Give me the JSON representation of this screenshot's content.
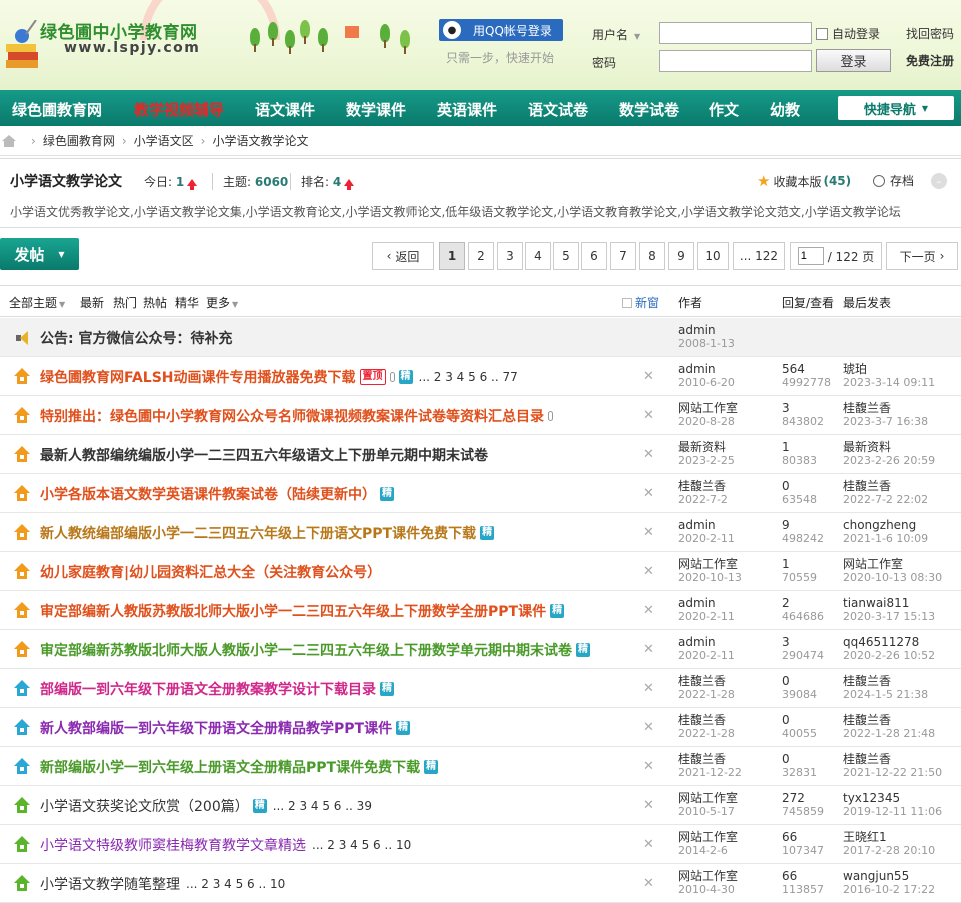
{
  "site": {
    "name": "绿色圃中小学教育网",
    "url": "www.lspjy.com"
  },
  "qq": {
    "button": "用QQ帐号登录",
    "hint": "只需一步，快速开始"
  },
  "login": {
    "username_label": "用户名",
    "password_label": "密码",
    "auto_login": "自动登录",
    "login_button": "登录",
    "forgot": "找回密码",
    "register": "免费注册"
  },
  "nav": {
    "items": [
      {
        "label": "绿色圃教育网"
      },
      {
        "label": "教学视频辅导"
      },
      {
        "label": "语文课件"
      },
      {
        "label": "数学课件"
      },
      {
        "label": "英语课件"
      },
      {
        "label": "语文试卷"
      },
      {
        "label": "数学试卷"
      },
      {
        "label": "作文"
      },
      {
        "label": "幼教"
      }
    ],
    "active_color": "#e52727",
    "quick_nav": "快捷导航"
  },
  "breadcrumb": [
    "绿色圃教育网",
    "小学语文区",
    "小学语文教学论文"
  ],
  "forum": {
    "title": "小学语文教学论文",
    "today_label": "今日:",
    "today": "1",
    "topics_label": "主题:",
    "topics": "6060",
    "rank_label": "排名:",
    "rank": "4",
    "favorite": "收藏本版",
    "favorite_count": "(45)",
    "archive": "存档",
    "tags": "小学语文优秀教学论文,小学语文教学论文集,小学语文教育论文,小学语文教师论文,低年级语文教学论文,小学语文教育教学论文,小学语文教学论文范文,小学语文教学论坛"
  },
  "toolbar": {
    "post_button": "发帖",
    "back": "返回",
    "pages": [
      "1",
      "2",
      "3",
      "4",
      "5",
      "6",
      "7",
      "8",
      "9",
      "10"
    ],
    "ellipsis_last": "... 122",
    "page_input": "1",
    "total_pages": "/ 122 页",
    "next": "下一页"
  },
  "list_header": {
    "all": "全部主题",
    "latest": "最新",
    "hot": "热门",
    "hotpost": "热帖",
    "digest": "精华",
    "more": "更多",
    "new_window": "新窗",
    "author": "作者",
    "reply_view": "回复/查看",
    "last_post": "最后发表"
  },
  "announcement": {
    "title": "公告: 官方微信公众号：待补充",
    "author": "admin",
    "date": "2008-1-13"
  },
  "topics": [
    {
      "title": "绿色圃教育网FALSH动画课件专用播放器免费下载",
      "color": "#e0501c",
      "icon": "orange",
      "hot": "置顶",
      "clip": true,
      "digest": "精",
      "pages": "... 2 3 4 5 6 .. 77",
      "author": "admin",
      "date": "2010-6-20",
      "replies": "564",
      "views": "4992778",
      "last_user": "琥珀",
      "last_date": "2023-3-14 09:11"
    },
    {
      "title": "特别推出：绿色圃中小学教育网公众号名师微课视频教案课件试卷等资料汇总目录",
      "color": "#e0501c",
      "icon": "orange",
      "clip": true,
      "author": "网站工作室",
      "date": "2020-8-28",
      "replies": "3",
      "views": "843802",
      "last_user": "桂馥兰香",
      "last_date": "2023-3-7 16:38"
    },
    {
      "title": "最新人教部编统编版小学一二三四五六年级语文上下册单元期中期末试卷",
      "color": "#333333",
      "icon": "orange",
      "author": "最新资料",
      "date": "2023-2-25",
      "replies": "1",
      "views": "80383",
      "last_user": "最新资料",
      "last_date": "2023-2-26 20:59"
    },
    {
      "title": "小学各版本语文数学英语课件教案试卷（陆续更新中）",
      "color": "#e0501c",
      "icon": "orange",
      "digest": "精",
      "author": "桂馥兰香",
      "date": "2022-7-2",
      "replies": "0",
      "views": "63548",
      "last_user": "桂馥兰香",
      "last_date": "2022-7-2 22:02"
    },
    {
      "title": "新人教统编部编版小学一二三四五六年级上下册语文PPT课件免费下载",
      "color": "#b8781a",
      "icon": "orange",
      "digest": "精",
      "author": "admin",
      "date": "2020-2-11",
      "replies": "9",
      "views": "498242",
      "last_user": "chongzheng",
      "last_date": "2021-1-6 10:09"
    },
    {
      "title": "幼儿家庭教育|幼儿园资料汇总大全（关注教育公众号）",
      "color": "#e0501c",
      "icon": "orange",
      "author": "网站工作室",
      "date": "2020-10-13",
      "replies": "1",
      "views": "70559",
      "last_user": "网站工作室",
      "last_date": "2020-10-13 08:30"
    },
    {
      "title": "审定部编新人教版苏教版北师大版小学一二三四五六年级上下册数学全册PPT课件",
      "color": "#e0501c",
      "icon": "orange",
      "digest": "精",
      "author": "admin",
      "date": "2020-2-11",
      "replies": "2",
      "views": "464686",
      "last_user": "tianwai811",
      "last_date": "2020-3-17 15:13"
    },
    {
      "title": "审定部编新苏教版北师大版人教版小学一二三四五六年级上下册数学单元期中期末试卷",
      "color": "#4a9a2a",
      "icon": "orange",
      "digest": "精",
      "author": "admin",
      "date": "2020-2-11",
      "replies": "3",
      "views": "290474",
      "last_user": "qq46511278",
      "last_date": "2020-2-26 10:52"
    },
    {
      "title": "部编版一到六年级下册语文全册教案教学设计下载目录",
      "color": "#d0278a",
      "icon": "blue",
      "digest": "精",
      "author": "桂馥兰香",
      "date": "2022-1-28",
      "replies": "0",
      "views": "39084",
      "last_user": "桂馥兰香",
      "last_date": "2024-1-5 21:38"
    },
    {
      "title": "新人教部编版一到六年级下册语文全册精品教学PPT课件",
      "color": "#8a2ab0",
      "icon": "blue",
      "digest": "精",
      "author": "桂馥兰香",
      "date": "2022-1-28",
      "replies": "0",
      "views": "40055",
      "last_user": "桂馥兰香",
      "last_date": "2022-1-28 21:48"
    },
    {
      "title": "新部编版小学一到六年级上册语文全册精品PPT课件免费下载",
      "color": "#4a9a2a",
      "icon": "blue",
      "digest": "精",
      "author": "桂馥兰香",
      "date": "2021-12-22",
      "replies": "0",
      "views": "32831",
      "last_user": "桂馥兰香",
      "last_date": "2021-12-22 21:50"
    },
    {
      "title": "小学语文获奖论文欣赏（200篇）",
      "color": "#333333",
      "icon": "green",
      "plain": true,
      "digest": "精",
      "pages": "... 2 3 4 5 6 .. 39",
      "author": "网站工作室",
      "date": "2010-5-17",
      "replies": "272",
      "views": "745859",
      "last_user": "tyx12345",
      "last_date": "2019-12-11 11:06"
    },
    {
      "title": "小学语文特级教师窦桂梅教育教学文章精选",
      "color": "#8a2ab0",
      "icon": "green",
      "plain": true,
      "pages": "... 2 3 4 5 6 .. 10",
      "author": "网站工作室",
      "date": "2014-2-6",
      "replies": "66",
      "views": "107347",
      "last_user": "王晓红1",
      "last_date": "2017-2-28 20:10"
    },
    {
      "title": "小学语文教学随笔整理",
      "color": "#333333",
      "icon": "green",
      "plain": true,
      "pages": "... 2 3 4 5 6 .. 10",
      "author": "网站工作室",
      "date": "2010-4-30",
      "replies": "66",
      "views": "113857",
      "last_user": "wangjun55",
      "last_date": "2016-10-2 17:22"
    }
  ]
}
